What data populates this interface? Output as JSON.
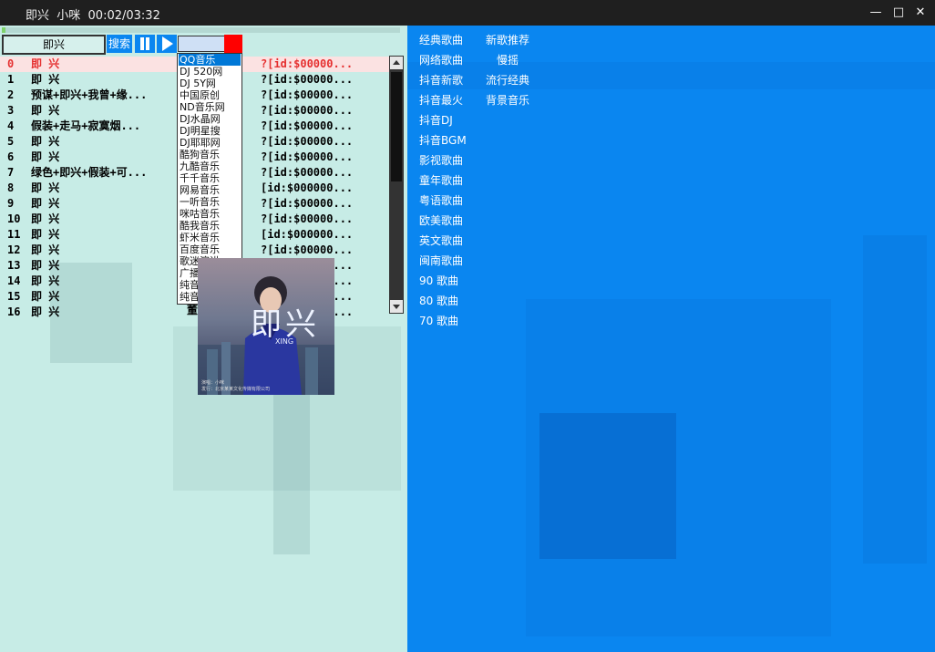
{
  "window": {
    "title": "即兴  小咪  00:02/03:32",
    "minimize_glyph": "—",
    "maximize_glyph": "□",
    "close_glyph": "✕"
  },
  "player": {
    "progress_fraction": 0.01,
    "search_value": "即兴",
    "search_label": "搜索",
    "source_select_value": ""
  },
  "songs": [
    {
      "index": "0",
      "title": "即 兴",
      "code": "?[id:$00000..."
    },
    {
      "index": "1",
      "title": "即 兴",
      "code": "?[id:$00000..."
    },
    {
      "index": "2",
      "title": "预谋+即兴+我曾+缘...",
      "code": "?[id:$00000..."
    },
    {
      "index": "3",
      "title": "即 兴",
      "code": "?[id:$00000..."
    },
    {
      "index": "4",
      "title": "假装+走马+寂寞烟...",
      "code": "?[id:$00000..."
    },
    {
      "index": "5",
      "title": "即 兴",
      "code": "?[id:$00000..."
    },
    {
      "index": "6",
      "title": "即 兴",
      "code": "?[id:$00000..."
    },
    {
      "index": "7",
      "title": "绿色+即兴+假装+可...",
      "code": "?[id:$00000..."
    },
    {
      "index": "8",
      "title": "即 兴",
      "code": "[id:$000000..."
    },
    {
      "index": "9",
      "title": "即 兴",
      "code": "?[id:$00000..."
    },
    {
      "index": "10",
      "title": "即 兴",
      "code": "?[id:$00000..."
    },
    {
      "index": "11",
      "title": "即 兴",
      "code": "[id:$000000..."
    },
    {
      "index": "12",
      "title": "即 兴",
      "code": "?[id:$00000..."
    },
    {
      "index": "13",
      "title": "即 兴",
      "code": "[id:$000000..."
    },
    {
      "index": "14",
      "title": "即 兴",
      "code": "?[id:$00000..."
    },
    {
      "index": "15",
      "title": "即 兴",
      "code": "?[id:$00000..."
    },
    {
      "index": "16",
      "title": "即 兴",
      "code": "?[id:$00000..."
    }
  ],
  "sources": [
    "QQ音乐",
    "DJ 520网",
    "DJ 5Y网",
    "中国原创",
    "ND音乐网",
    "DJ水晶网",
    "DJ明星搜",
    "DJ耶耶网",
    "酷狗音乐",
    "九酷音乐",
    "千千音乐",
    "网易音乐",
    "一听音乐",
    "咪咕音乐",
    "酷我音乐",
    "虾米音乐",
    "百度音乐",
    "歌迷演讲",
    "广播历史",
    "纯音乐",
    "纯音听蛙"
  ],
  "bottom_partial_text": "董心羽",
  "categories_left": [
    "经典歌曲",
    "网络歌曲",
    "抖音新歌",
    "抖音最火",
    "抖音DJ",
    "抖音BGM",
    "影视歌曲",
    "童年歌曲",
    "粤语歌曲",
    "欧美歌曲",
    "英文歌曲",
    "闽南歌曲",
    "90 歌曲",
    "80 歌曲",
    "70 歌曲"
  ],
  "categories_right": [
    "新歌推荐",
    "慢摇",
    "流行经典",
    "背景音乐"
  ],
  "album": {
    "big_text": "即兴",
    "tag_text": "XING",
    "small_text": "演唱：小咪\n发行：北京某某文化传媒有限公司"
  },
  "colors": {
    "accent": "#0a86f0",
    "left_bg": "#c7ece6",
    "active_row_text": "#e53030",
    "progress": "#7fd36c"
  }
}
